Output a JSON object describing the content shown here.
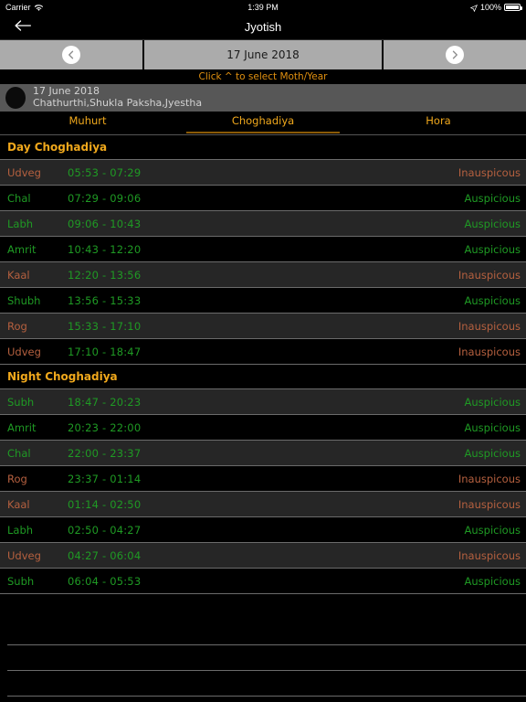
{
  "status_bar": {
    "carrier": "Carrier",
    "wifi_icon": "wifi-icon",
    "time": "1:39 PM",
    "location_icon": "location-arrow-icon",
    "battery_percent": "100%",
    "battery_icon": "battery-icon"
  },
  "nav": {
    "back_icon": "back-arrow-icon",
    "title": "Jyotish"
  },
  "date_bar": {
    "prev_icon": "chevron-left-icon",
    "date": "17 June 2018",
    "next_icon": "chevron-right-icon",
    "hint": "Click ^ to select Moth/Year"
  },
  "info": {
    "moon_icon": "moon-icon",
    "date": "17 June 2018",
    "panchang": "Chathurthi,Shukla Paksha,Jyestha"
  },
  "tabs": [
    {
      "label": "Muhurt",
      "active": false
    },
    {
      "label": "Choghadiya",
      "active": true
    },
    {
      "label": "Hora",
      "active": false
    }
  ],
  "colors": {
    "accent_orange": "#f0a81c",
    "auspicious_green": "#1f9a24",
    "inauspicious_red": "#b5603f",
    "row_alt_bg": "#262626",
    "segment_gray": "#ababab"
  },
  "sections": [
    {
      "title": "Day Choghadiya",
      "rows": [
        {
          "name": "Udveg",
          "time": "05:53 - 07:29",
          "status": "Inauspicous",
          "good": false
        },
        {
          "name": "Chal",
          "time": "07:29 - 09:06",
          "status": "Auspicious",
          "good": true
        },
        {
          "name": "Labh",
          "time": "09:06 - 10:43",
          "status": "Auspicious",
          "good": true
        },
        {
          "name": "Amrit",
          "time": "10:43 - 12:20",
          "status": "Auspicious",
          "good": true
        },
        {
          "name": "Kaal",
          "time": "12:20 - 13:56",
          "status": "Inauspicous",
          "good": false
        },
        {
          "name": "Shubh",
          "time": "13:56 - 15:33",
          "status": "Auspicious",
          "good": true
        },
        {
          "name": "Rog",
          "time": "15:33 - 17:10",
          "status": "Inauspicous",
          "good": false
        },
        {
          "name": "Udveg",
          "time": "17:10 - 18:47",
          "status": "Inauspicous",
          "good": false
        }
      ]
    },
    {
      "title": "Night Choghadiya",
      "rows": [
        {
          "name": "Subh",
          "time": "18:47 - 20:23",
          "status": "Auspicious",
          "good": true
        },
        {
          "name": "Amrit",
          "time": "20:23 - 22:00",
          "status": "Auspicious",
          "good": true
        },
        {
          "name": "Chal",
          "time": "22:00 - 23:37",
          "status": "Auspicious",
          "good": true
        },
        {
          "name": "Rog",
          "time": "23:37 - 01:14",
          "status": "Inauspicous",
          "good": false
        },
        {
          "name": "Kaal",
          "time": "01:14 - 02:50",
          "status": "Inauspicous",
          "good": false
        },
        {
          "name": "Labh",
          "time": "02:50 - 04:27",
          "status": "Auspicious",
          "good": true
        },
        {
          "name": "Udveg",
          "time": "04:27 - 06:04",
          "status": "Inauspicous",
          "good": false
        },
        {
          "name": "Subh",
          "time": "06:04 - 05:53",
          "status": "Auspicious",
          "good": true
        }
      ]
    }
  ],
  "empty_rows": 3
}
